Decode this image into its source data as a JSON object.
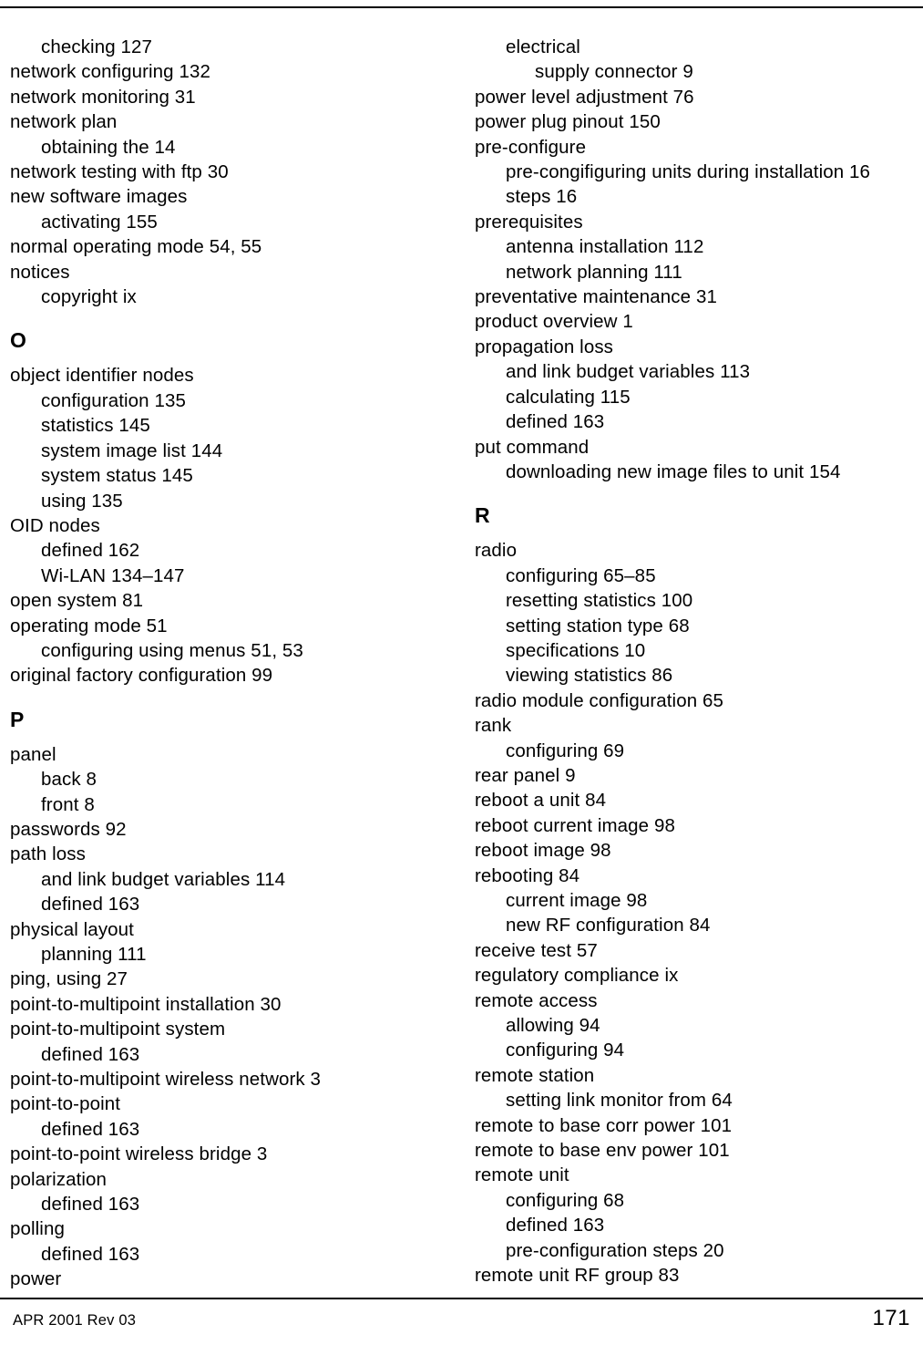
{
  "document": {
    "page_number": "171",
    "footer_left": "APR 2001 Rev 03"
  },
  "index": {
    "left_column": [
      {
        "level": 1,
        "text": "checking 127"
      },
      {
        "level": 0,
        "text": "network configuring 132"
      },
      {
        "level": 0,
        "text": "network monitoring 31"
      },
      {
        "level": 0,
        "text": "network plan"
      },
      {
        "level": 1,
        "text": "obtaining the 14"
      },
      {
        "level": 0,
        "text": "network testing with ftp 30"
      },
      {
        "level": 0,
        "text": "new software images"
      },
      {
        "level": 1,
        "text": "activating 155"
      },
      {
        "level": 0,
        "text": "normal operating mode 54, 55"
      },
      {
        "level": 0,
        "text": "notices"
      },
      {
        "level": 1,
        "text": "copyright ix"
      },
      {
        "level": "letter",
        "text": "O"
      },
      {
        "level": 0,
        "text": "object identifier nodes"
      },
      {
        "level": 1,
        "text": "configuration 135"
      },
      {
        "level": 1,
        "text": "statistics 145"
      },
      {
        "level": 1,
        "text": "system image list 144"
      },
      {
        "level": 1,
        "text": "system status 145"
      },
      {
        "level": 1,
        "text": "using 135"
      },
      {
        "level": 0,
        "text": "OID nodes"
      },
      {
        "level": 1,
        "text": "defined 162"
      },
      {
        "level": 1,
        "text": "Wi-LAN 134–147"
      },
      {
        "level": 0,
        "text": "open system 81"
      },
      {
        "level": 0,
        "text": "operating mode 51"
      },
      {
        "level": 1,
        "text": "configuring using menus 51, 53"
      },
      {
        "level": 0,
        "text": "original factory configuration 99"
      },
      {
        "level": "letter",
        "text": "P"
      },
      {
        "level": 0,
        "text": "panel"
      },
      {
        "level": 1,
        "text": "back 8"
      },
      {
        "level": 1,
        "text": "front 8"
      },
      {
        "level": 0,
        "text": "passwords 92"
      },
      {
        "level": 0,
        "text": "path loss"
      },
      {
        "level": 1,
        "text": "and link budget variables 114"
      },
      {
        "level": 1,
        "text": "defined 163"
      },
      {
        "level": 0,
        "text": "physical layout"
      },
      {
        "level": 1,
        "text": "planning 111"
      },
      {
        "level": 0,
        "text": "ping, using 27"
      },
      {
        "level": 0,
        "text": "point-to-multipoint installation 30"
      },
      {
        "level": 0,
        "text": "point-to-multipoint system"
      },
      {
        "level": 1,
        "text": "defined 163"
      },
      {
        "level": 0,
        "text": "point-to-multipoint wireless network 3"
      },
      {
        "level": 0,
        "text": "point-to-point"
      },
      {
        "level": 1,
        "text": "defined 163"
      },
      {
        "level": 0,
        "text": "point-to-point wireless bridge 3"
      },
      {
        "level": 0,
        "text": "polarization"
      },
      {
        "level": 1,
        "text": "defined 163"
      },
      {
        "level": 0,
        "text": "polling"
      },
      {
        "level": 1,
        "text": "defined 163"
      },
      {
        "level": 0,
        "text": "power"
      }
    ],
    "right_column": [
      {
        "level": 1,
        "text": "electrical"
      },
      {
        "level": 2,
        "text": "supply connector 9"
      },
      {
        "level": 0,
        "text": "power level adjustment 76"
      },
      {
        "level": 0,
        "text": "power plug pinout 150"
      },
      {
        "level": 0,
        "text": "pre-configure"
      },
      {
        "level": 1,
        "text": "pre-congifiguring units during installation 16"
      },
      {
        "level": 1,
        "text": "steps 16"
      },
      {
        "level": 0,
        "text": "prerequisites"
      },
      {
        "level": 1,
        "text": "antenna installation 112"
      },
      {
        "level": 1,
        "text": "network planning 111"
      },
      {
        "level": 0,
        "text": "preventative maintenance 31"
      },
      {
        "level": 0,
        "text": "product overview 1"
      },
      {
        "level": 0,
        "text": "propagation loss"
      },
      {
        "level": 1,
        "text": "and link budget variables 113"
      },
      {
        "level": 1,
        "text": "calculating 115"
      },
      {
        "level": 1,
        "text": "defined 163"
      },
      {
        "level": 0,
        "text": "put command"
      },
      {
        "level": 1,
        "text": "downloading new image files to unit 154"
      },
      {
        "level": "letter",
        "text": "R"
      },
      {
        "level": 0,
        "text": "radio"
      },
      {
        "level": 1,
        "text": "configuring 65–85"
      },
      {
        "level": 1,
        "text": "resetting statistics 100"
      },
      {
        "level": 1,
        "text": "setting station type 68"
      },
      {
        "level": 1,
        "text": "specifications 10"
      },
      {
        "level": 1,
        "text": "viewing statistics 86"
      },
      {
        "level": 0,
        "text": "radio module configuration 65"
      },
      {
        "level": 0,
        "text": "rank"
      },
      {
        "level": 1,
        "text": "configuring 69"
      },
      {
        "level": 0,
        "text": "rear panel 9"
      },
      {
        "level": 0,
        "text": "reboot a unit 84"
      },
      {
        "level": 0,
        "text": "reboot current image 98"
      },
      {
        "level": 0,
        "text": "reboot image 98"
      },
      {
        "level": 0,
        "text": "rebooting 84"
      },
      {
        "level": 1,
        "text": "current image 98"
      },
      {
        "level": 1,
        "text": "new RF configuration 84"
      },
      {
        "level": 0,
        "text": "receive test 57"
      },
      {
        "level": 0,
        "text": "regulatory compliance ix"
      },
      {
        "level": 0,
        "text": "remote access"
      },
      {
        "level": 1,
        "text": "allowing 94"
      },
      {
        "level": 1,
        "text": "configuring 94"
      },
      {
        "level": 0,
        "text": "remote station"
      },
      {
        "level": 1,
        "text": "setting link monitor from 64"
      },
      {
        "level": 0,
        "text": "remote to base corr power 101"
      },
      {
        "level": 0,
        "text": "remote to base env power 101"
      },
      {
        "level": 0,
        "text": "remote unit"
      },
      {
        "level": 1,
        "text": "configuring 68"
      },
      {
        "level": 1,
        "text": "defined 163"
      },
      {
        "level": 1,
        "text": "pre-configuration steps 20"
      },
      {
        "level": 0,
        "text": "remote unit RF group 83"
      }
    ]
  }
}
